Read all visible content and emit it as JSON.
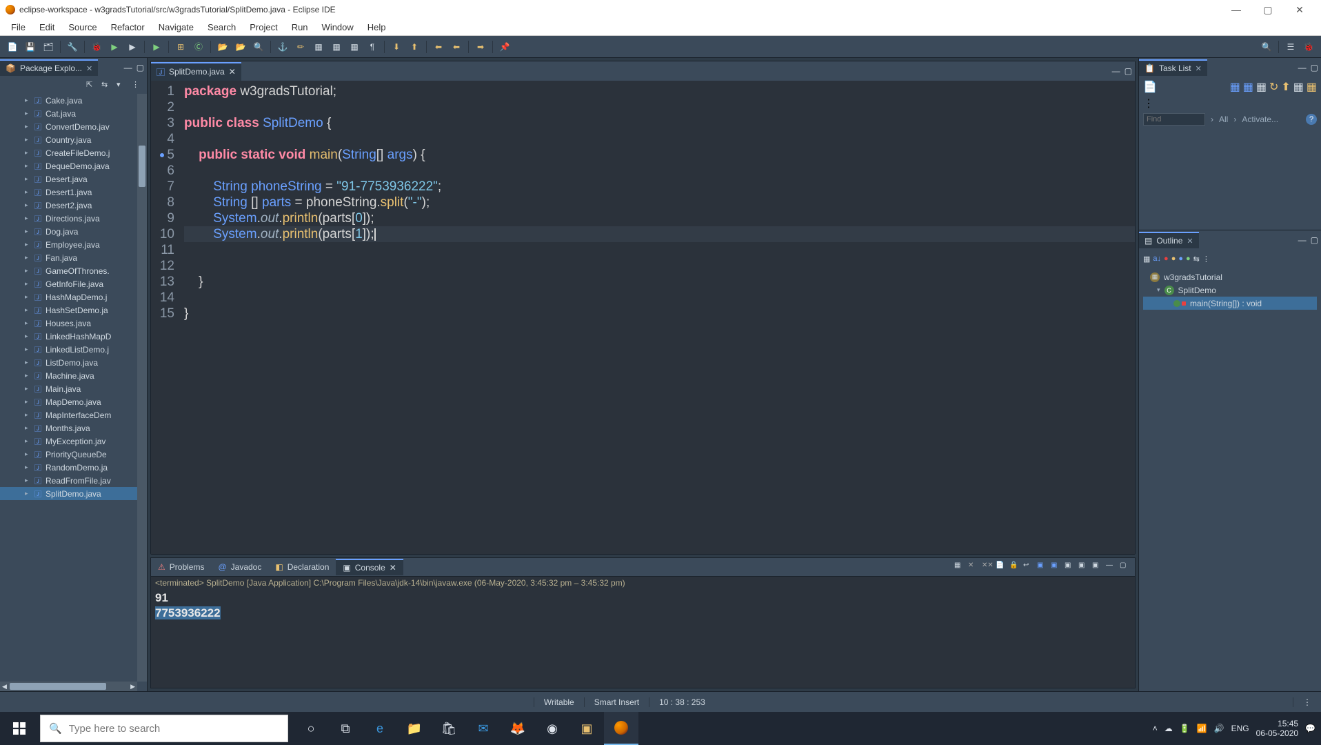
{
  "window": {
    "title": "eclipse-workspace - w3gradsTutorial/src/w3gradsTutorial/SplitDemo.java - Eclipse IDE"
  },
  "menubar": [
    "File",
    "Edit",
    "Source",
    "Refactor",
    "Navigate",
    "Search",
    "Project",
    "Run",
    "Window",
    "Help"
  ],
  "package_explorer": {
    "tab_label": "Package Explo...",
    "files": [
      "Cake.java",
      "Cat.java",
      "ConvertDemo.jav",
      "Country.java",
      "CreateFileDemo.j",
      "DequeDemo.java",
      "Desert.java",
      "Desert1.java",
      "Desert2.java",
      "Directions.java",
      "Dog.java",
      "Employee.java",
      "Fan.java",
      "GameOfThrones.",
      "GetInfoFile.java",
      "HashMapDemo.j",
      "HashSetDemo.ja",
      "Houses.java",
      "LinkedHashMapD",
      "LinkedListDemo.j",
      "ListDemo.java",
      "Machine.java",
      "Main.java",
      "MapDemo.java",
      "MapInterfaceDem",
      "Months.java",
      "MyException.jav",
      "PriorityQueueDe",
      "RandomDemo.ja",
      "ReadFromFile.jav",
      "SplitDemo.java"
    ],
    "selected": "SplitDemo.java"
  },
  "editor": {
    "tab_label": "SplitDemo.java",
    "line_numbers": [
      "1",
      "2",
      "3",
      "4",
      "5",
      "6",
      "7",
      "8",
      "9",
      "10",
      "11",
      "12",
      "13",
      "14",
      "15"
    ],
    "marker_line": 5,
    "code": {
      "package_kw": "package",
      "package_name": "w3gradsTutorial",
      "public_kw": "public",
      "class_kw": "class",
      "class_name": "SplitDemo",
      "static_kw": "static",
      "void_kw": "void",
      "main_name": "main",
      "string_type": "String",
      "args_name": "args",
      "phone_var": "phoneString",
      "phone_val": "\"91-7753936222\"",
      "parts_var": "parts",
      "split_name": "split",
      "dash_lit": "\"-\"",
      "system_name": "System",
      "out_name": "out",
      "println_name": "println",
      "idx0": "0",
      "idx1": "1"
    }
  },
  "bottom": {
    "tabs": {
      "problems": "Problems",
      "javadoc": "Javadoc",
      "declaration": "Declaration",
      "console": "Console"
    },
    "console_desc": "<terminated> SplitDemo [Java Application] C:\\Program Files\\Java\\jdk-14\\bin\\javaw.exe  (06-May-2020, 3:45:32 pm – 3:45:32 pm)",
    "out_line1": "91",
    "out_line2": "7753936222"
  },
  "tasklist": {
    "tab_label": "Task List",
    "find_placeholder": "Find",
    "all_label": "All",
    "activate_label": "Activate..."
  },
  "outline": {
    "tab_label": "Outline",
    "pkg": "w3gradsTutorial",
    "cls": "SplitDemo",
    "method": "main(String[]) : void"
  },
  "status": {
    "writable": "Writable",
    "insert": "Smart Insert",
    "pos": "10 : 38 : 253"
  },
  "taskbar": {
    "search_placeholder": "Type here to search",
    "lang": "ENG",
    "time": "15:45",
    "date": "06-05-2020"
  }
}
